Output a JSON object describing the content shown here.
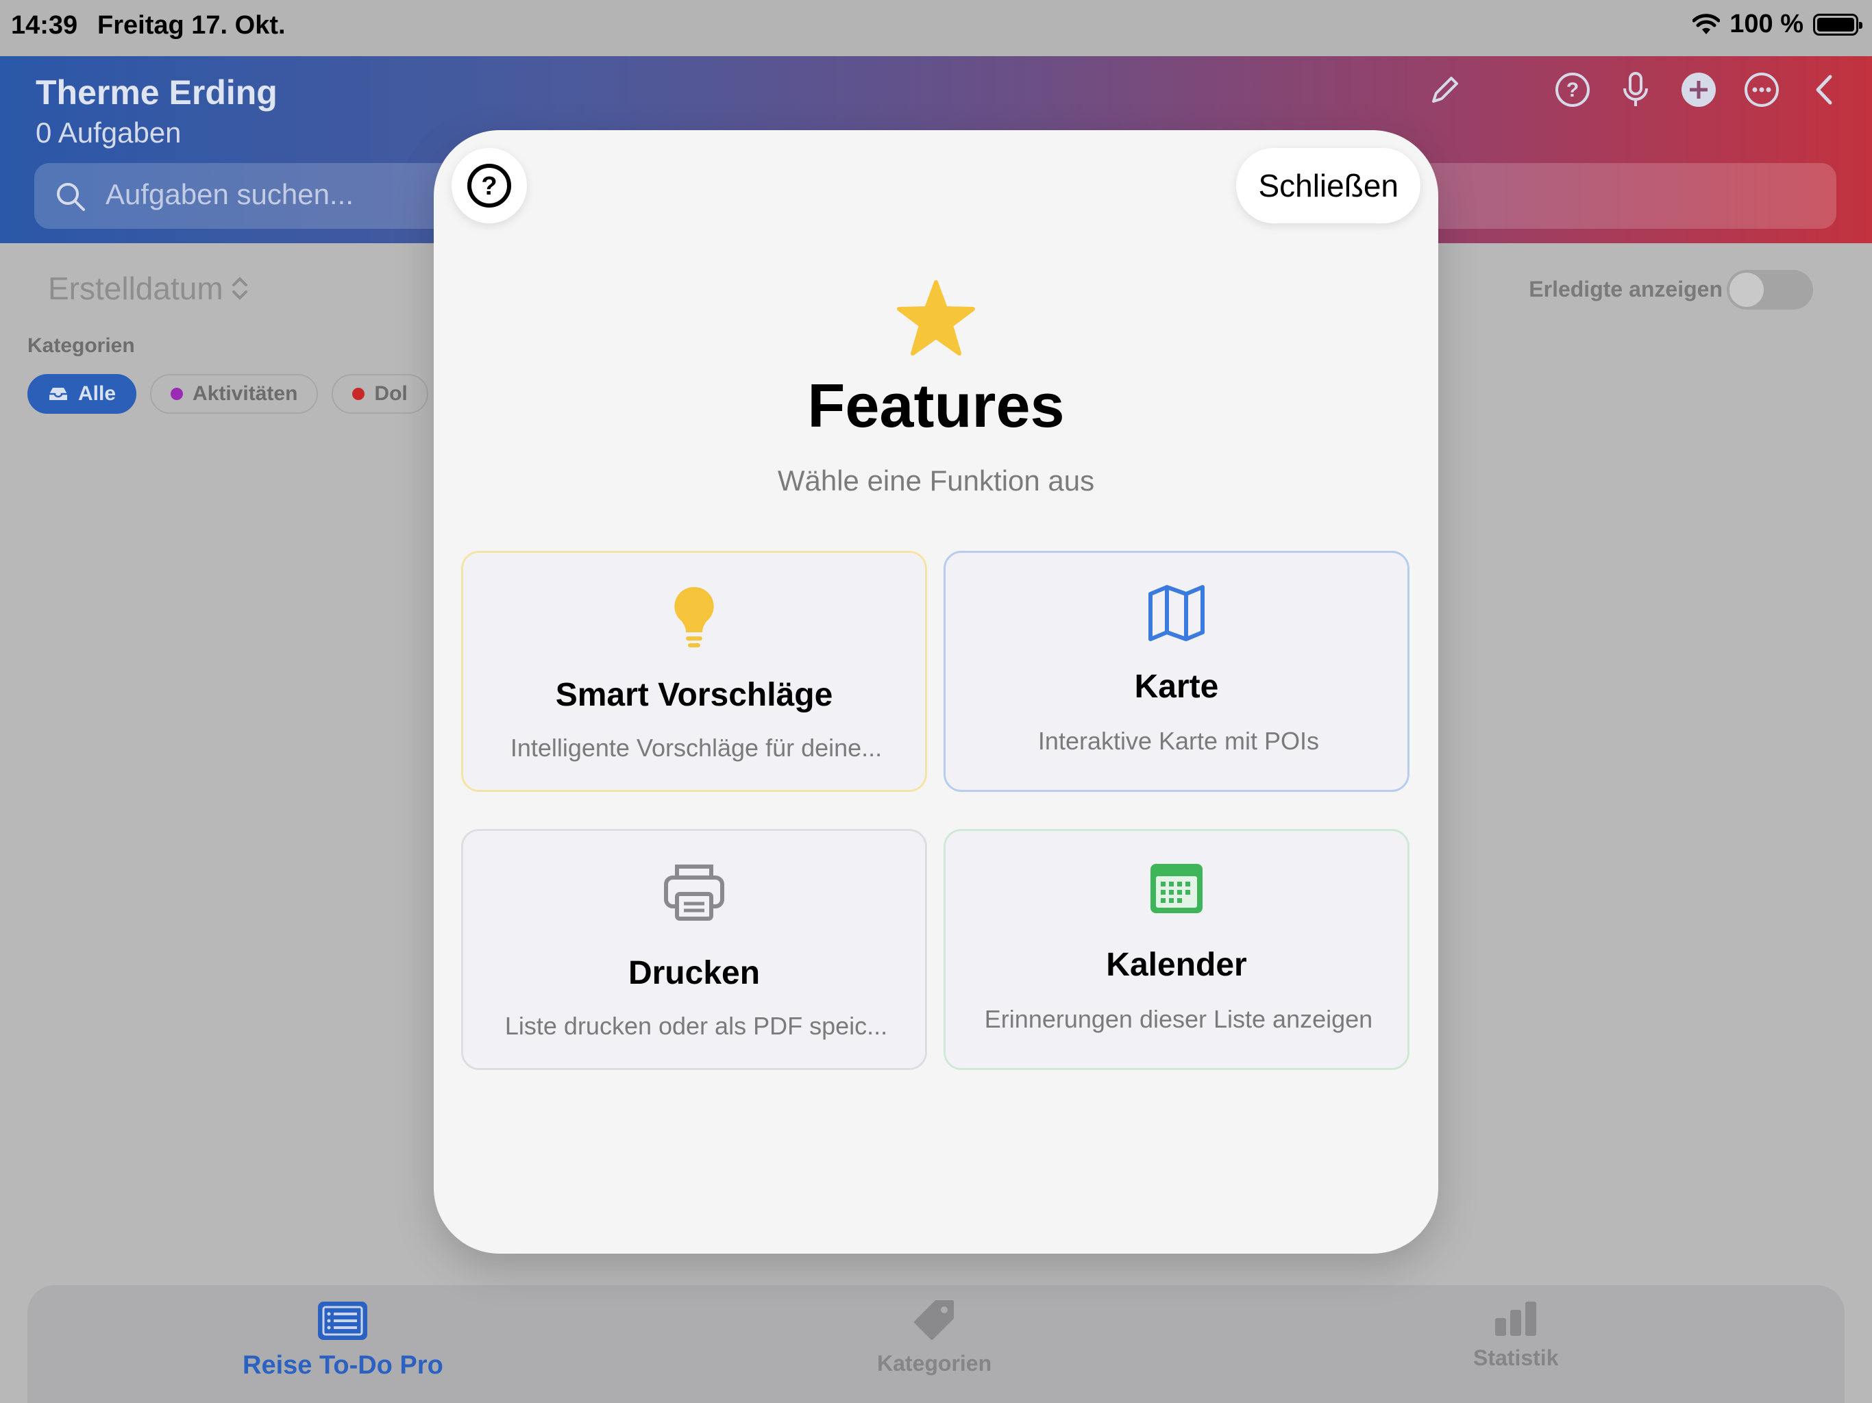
{
  "status_bar": {
    "time": "14:39",
    "date": "Freitag 17. Okt.",
    "battery": "100 %"
  },
  "header": {
    "title": "Therme Erding",
    "subtitle": "0 Aufgaben",
    "search_placeholder": "Aufgaben suchen...",
    "icons": [
      "pencil-icon",
      "help-icon",
      "microphone-icon",
      "add-icon",
      "more-icon",
      "back-icon"
    ]
  },
  "filters": {
    "sort_label": "Erstelldatum",
    "show_done_label": "Erledigte anzeigen",
    "show_done_on": false,
    "categories_title": "Kategorien",
    "chips": [
      {
        "label": "Alle",
        "active": true
      },
      {
        "label": "Aktivitäten",
        "color": "#9b2bb5"
      },
      {
        "label": "Dol",
        "color": "#c92828"
      }
    ]
  },
  "modal": {
    "close_label": "Schließen",
    "title": "Features",
    "subtitle": "Wähle eine Funktion aus",
    "star_color": "#f7c53a",
    "cards": [
      {
        "title": "Smart Vorschläge",
        "description": "Intelligente Vorschläge für deine...",
        "icon": "lightbulb-icon",
        "color": "#f6c43a"
      },
      {
        "title": "Karte",
        "description": "Interaktive Karte mit POIs",
        "icon": "map-icon",
        "color": "#3b7be0"
      },
      {
        "title": "Drucken",
        "description": "Liste drucken oder als PDF speic...",
        "icon": "printer-icon",
        "color": "#8a8a8e"
      },
      {
        "title": "Kalender",
        "description": "Erinnerungen dieser Liste anzeigen",
        "icon": "calendar-icon",
        "color": "#3fb55a"
      }
    ]
  },
  "tabbar": {
    "tabs": [
      {
        "label": "Reise To-Do Pro",
        "icon": "list-icon",
        "active": true
      },
      {
        "label": "Kategorien",
        "icon": "tag-icon"
      },
      {
        "label": "Statistik",
        "icon": "chart-icon"
      }
    ]
  }
}
